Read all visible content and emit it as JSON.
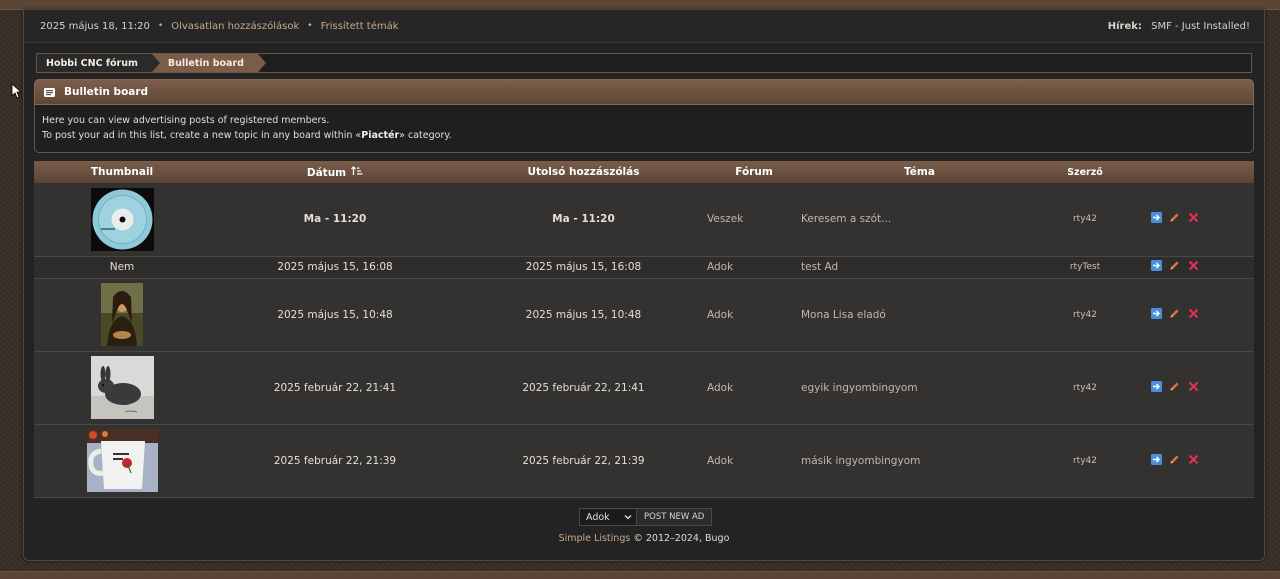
{
  "upper": {
    "datetime": "2025 május 18, 11:20",
    "links": [
      "Olvasatlan hozzászólások",
      "Frissített témák"
    ],
    "news_label": "Hírek:",
    "news_text": "SMF - Just Installed!"
  },
  "breadcrumb": [
    "Hobbi CNC fórum",
    "Bulletin board"
  ],
  "category": {
    "title": "Bulletin board",
    "line1": "Here you can view advertising posts of registered members.",
    "line2_pre": "To post your ad in this list, create a new topic in any board within «",
    "line2_bold": "Piactér",
    "line2_post": "» category."
  },
  "table": {
    "headers": {
      "thumbnail": "Thumbnail",
      "date": "Dátum",
      "last_post": "Utolsó hozzászólás",
      "forum": "Fórum",
      "topic": "Téma",
      "author": "Szerző"
    },
    "rows": [
      {
        "thumb": "cd",
        "date": "Ma - 11:20",
        "last": "Ma - 11:20",
        "forum": "Veszek",
        "topic": "Keresem a szót...",
        "author": "rty42"
      },
      {
        "thumb": "none",
        "thumb_text": "Nem",
        "date": "2025 május 15, 16:08",
        "last": "2025 május 15, 16:08",
        "forum": "Adok",
        "topic": "test Ad",
        "author": "rtyTest"
      },
      {
        "thumb": "monalisa",
        "date": "2025 május 15, 10:48",
        "last": "2025 május 15, 10:48",
        "forum": "Adok",
        "topic": "Mona Lisa eladó",
        "author": "rty42"
      },
      {
        "thumb": "rabbit",
        "date": "2025 február 22, 21:41",
        "last": "2025 február 22, 21:41",
        "forum": "Adok",
        "topic": "egyik ingyombingyom",
        "author": "rty42"
      },
      {
        "thumb": "mug",
        "date": "2025 február 22, 21:39",
        "last": "2025 február 22, 21:39",
        "forum": "Adok",
        "topic": "másik ingyombingyom",
        "author": "rty42"
      }
    ]
  },
  "controls": {
    "select_value": "Adok",
    "post_button": "POST NEW AD"
  },
  "footer": {
    "link": "Simple Listings",
    "text": " © 2012–2024, Bugo"
  },
  "colors": {
    "accent": "#7a5c48",
    "link": "#c9a98b",
    "delete": "#e0344d",
    "move": "#4a8fdc",
    "edit": "#e8703a"
  },
  "icons": [
    "mouse-cursor-icon",
    "board-icon",
    "sort-ascending-icon",
    "move-icon",
    "edit-icon",
    "delete-icon",
    "chevron-down-icon"
  ]
}
